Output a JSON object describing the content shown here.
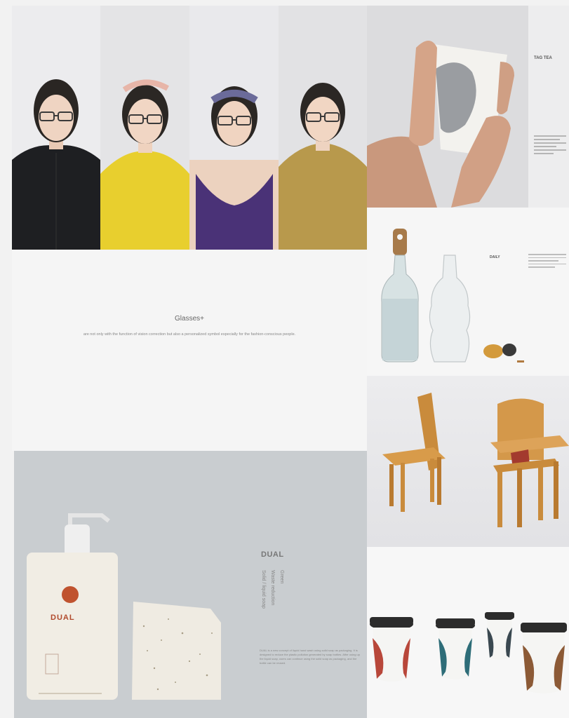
{
  "glasses": {
    "title": "Glasses+",
    "description": "are not only with the function of vision correction but also a personalized symbol especially for the fashion-conscious people."
  },
  "cup": {
    "title": "TAG TEA"
  },
  "bottle": {
    "title": "DAILY"
  },
  "dual": {
    "title": "DUAL",
    "tagline_1": "Green",
    "tagline_2": "Waste reduction",
    "tagline_3": "Solid / liquid soap",
    "product_label": "DUAL",
    "body_text": "DUAL is a new concept of liquid hand wash using solid soap as packaging. It is designed to reduce the plastic pollution generated by soap bottles. After using up the liquid soap, users can continue using the solid soap as packaging, and the bottle can be reused."
  },
  "colors": {
    "page_bg": "#f2f2f2",
    "dual_bg": "#c9cdd0",
    "wood": "#c98b3c",
    "cup_red": "#b8473a",
    "cup_teal": "#2e6d78",
    "cup_brown": "#8c5a36"
  }
}
